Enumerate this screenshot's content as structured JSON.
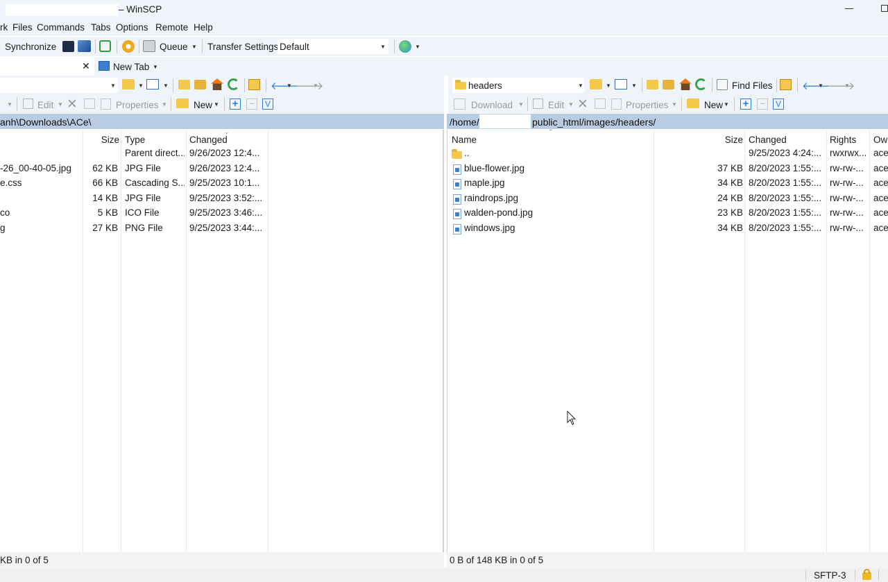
{
  "window": {
    "title": "– WinSCP"
  },
  "menu": [
    "rk",
    "Files",
    "Commands",
    "Tabs",
    "Options",
    "Remote",
    "Help"
  ],
  "toolbar": {
    "synchronize": "Synchronize",
    "queue": "Queue",
    "transfer_settings": "Transfer Settings",
    "transfer_profile": "Default"
  },
  "tabs": {
    "new_tab": "New Tab",
    "close": "✕"
  },
  "left": {
    "commands": {
      "edit": "Edit",
      "properties": "Properties",
      "new": "New"
    },
    "path": "anh\\Downloads\\ACe\\",
    "columns": {
      "size": "Size",
      "type": "Type",
      "changed": "Changed"
    },
    "rows": [
      {
        "name": "",
        "size": "",
        "type": "Parent direct...",
        "changed": "9/26/2023 12:4..."
      },
      {
        "name": "-26_00-40-05.jpg",
        "size": "62 KB",
        "type": "JPG File",
        "changed": "9/26/2023 12:4..."
      },
      {
        "name": "e.css",
        "size": "66 KB",
        "type": "Cascading S...",
        "changed": "9/25/2023 10:1..."
      },
      {
        "name": "",
        "size": "14 KB",
        "type": "JPG File",
        "changed": "9/25/2023 3:52:..."
      },
      {
        "name": "co",
        "size": "5 KB",
        "type": "ICO File",
        "changed": "9/25/2023 3:46:..."
      },
      {
        "name": "g",
        "size": "27 KB",
        "type": "PNG File",
        "changed": "9/25/2023 3:44:..."
      }
    ],
    "status": "KB in 0 of 5"
  },
  "right": {
    "folder_combo": "headers",
    "find_files": "Find Files",
    "commands": {
      "download": "Download",
      "edit": "Edit",
      "properties": "Properties",
      "new": "New"
    },
    "path_prefix": "/home/",
    "path_suffix": "public_html/images/headers/",
    "columns": {
      "name": "Name",
      "size": "Size",
      "changed": "Changed",
      "rights": "Rights",
      "owner": "Owr"
    },
    "rows": [
      {
        "name": "..",
        "size": "",
        "changed": "9/25/2023 4:24:...",
        "rights": "rwxrwx...",
        "owner": "acer"
      },
      {
        "name": "blue-flower.jpg",
        "size": "37 KB",
        "changed": "8/20/2023 1:55:...",
        "rights": "rw-rw-...",
        "owner": "acer"
      },
      {
        "name": "maple.jpg",
        "size": "34 KB",
        "changed": "8/20/2023 1:55:...",
        "rights": "rw-rw-...",
        "owner": "acer"
      },
      {
        "name": "raindrops.jpg",
        "size": "24 KB",
        "changed": "8/20/2023 1:55:...",
        "rights": "rw-rw-...",
        "owner": "acer"
      },
      {
        "name": "walden-pond.jpg",
        "size": "23 KB",
        "changed": "8/20/2023 1:55:...",
        "rights": "rw-rw-...",
        "owner": "acer"
      },
      {
        "name": "windows.jpg",
        "size": "34 KB",
        "changed": "8/20/2023 1:55:...",
        "rights": "rw-rw-...",
        "owner": "acer"
      }
    ],
    "status": "0 B of 148 KB in 0 of 5"
  },
  "footer": {
    "protocol": "SFTP-3"
  },
  "colors": {
    "chrome": "#eff4fb",
    "address_bar": "#b8cde4",
    "accent": "#3b7fd0",
    "folder": "#f3c84b"
  }
}
